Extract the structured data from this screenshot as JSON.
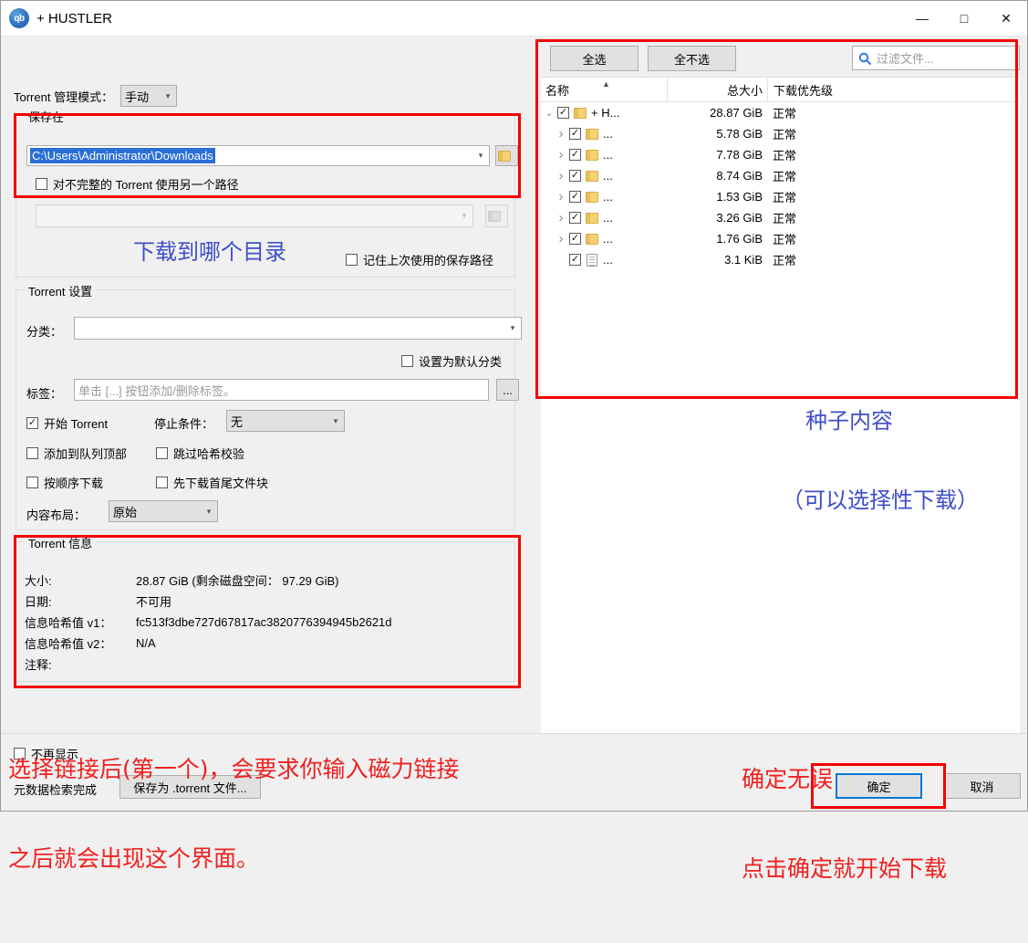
{
  "window": {
    "title": "+ HUSTLER",
    "logo_text": "qb",
    "minimize": "—",
    "maximize": "□",
    "close": "✕"
  },
  "management": {
    "label": "Torrent 管理模式：",
    "value": "手动"
  },
  "save_group": {
    "title": "保存在",
    "path_value": "C:\\Users\\Administrator\\Downloads",
    "folder_icon": "folder-icon",
    "incomplete_checkbox": {
      "label": "对不完整的 Torrent 使用另一个路径",
      "checked": false
    },
    "incomplete_path_value": "",
    "remember_checkbox": {
      "label": "记住上次使用的保存路径",
      "checked": false
    }
  },
  "torrent_settings": {
    "title": "Torrent 设置",
    "category_label": "分类：",
    "category_value": "",
    "default_category_checkbox": {
      "label": "设置为默认分类",
      "checked": false
    },
    "tags_label": "标签：",
    "tags_placeholder": "单击 [...] 按钮添加/删除标签。",
    "tags_button": "...",
    "start_torrent_checkbox": {
      "label": "开始 Torrent",
      "checked": true
    },
    "stop_condition_label": "停止条件：",
    "stop_condition_value": "无",
    "add_to_top_checkbox": {
      "label": "添加到队列顶部",
      "checked": false
    },
    "skip_hash_checkbox": {
      "label": "跳过哈希校验",
      "checked": false
    },
    "sequential_checkbox": {
      "label": "按顺序下载",
      "checked": false
    },
    "first_last_checkbox": {
      "label": "先下载首尾文件块",
      "checked": false
    },
    "content_layout_label": "内容布局：",
    "content_layout_value": "原始"
  },
  "torrent_info": {
    "title": "Torrent 信息",
    "rows": [
      {
        "label": "大小:",
        "value": "28.87 GiB  (剩余磁盘空间： 97.29 GiB)"
      },
      {
        "label": "日期:",
        "value": "不可用"
      },
      {
        "label": "信息哈希值 v1：",
        "value": "fc513f3dbe727d67817ac3820776394945b2621d"
      },
      {
        "label": "信息哈希值 v2：",
        "value": "N/A"
      },
      {
        "label": "注释:",
        "value": ""
      }
    ]
  },
  "filelist": {
    "select_all": "全选",
    "select_none": "全不选",
    "filter_placeholder": "过滤文件...",
    "search_icon": "search-icon",
    "columns": [
      "名称",
      "总大小",
      "下载优先级"
    ],
    "rows": [
      {
        "indent": 0,
        "twisty": "⌄",
        "icon": "folder",
        "name": "+ H...",
        "size": "28.87 GiB",
        "priority": "正常",
        "checked": true
      },
      {
        "indent": 1,
        "twisty": "›",
        "icon": "folder",
        "name": "...",
        "size": "5.78 GiB",
        "priority": "正常",
        "checked": true
      },
      {
        "indent": 1,
        "twisty": "›",
        "icon": "folder",
        "name": "...",
        "size": "7.78 GiB",
        "priority": "正常",
        "checked": true
      },
      {
        "indent": 1,
        "twisty": "›",
        "icon": "folder",
        "name": "...",
        "size": "8.74 GiB",
        "priority": "正常",
        "checked": true
      },
      {
        "indent": 1,
        "twisty": "›",
        "icon": "folder",
        "name": "...",
        "size": "1.53 GiB",
        "priority": "正常",
        "checked": true
      },
      {
        "indent": 1,
        "twisty": "›",
        "icon": "folder",
        "name": "...",
        "size": "3.26 GiB",
        "priority": "正常",
        "checked": true
      },
      {
        "indent": 1,
        "twisty": "›",
        "icon": "folder",
        "name": "...",
        "size": "1.76 GiB",
        "priority": "正常",
        "checked": true
      },
      {
        "indent": 1,
        "twisty": "",
        "icon": "file",
        "name": "...",
        "size": "3.1 KiB",
        "priority": "正常",
        "checked": true
      }
    ]
  },
  "footer": {
    "dont_show_checkbox": {
      "label": "不再显示",
      "checked": false
    },
    "status_text": "元数据检索完成",
    "save_torrent_button": "保存为 .torrent 文件...",
    "ok_button": "确定",
    "cancel_button": "取消"
  },
  "annotations": {
    "blue_color": "#3f4ec8",
    "red_color": "#f02020",
    "download_dir": "下载到哪个目录",
    "torrent_content_line1": "种子内容",
    "torrent_content_line2": "（可以选择性下载）",
    "bottom_left_line1": "选择链接后(第一个)，会要求你输入磁力链接",
    "bottom_left_line2": "之后就会出现这个界面。",
    "bottom_right_line1": "确定无误",
    "bottom_right_line2": "点击确定就开始下载"
  }
}
